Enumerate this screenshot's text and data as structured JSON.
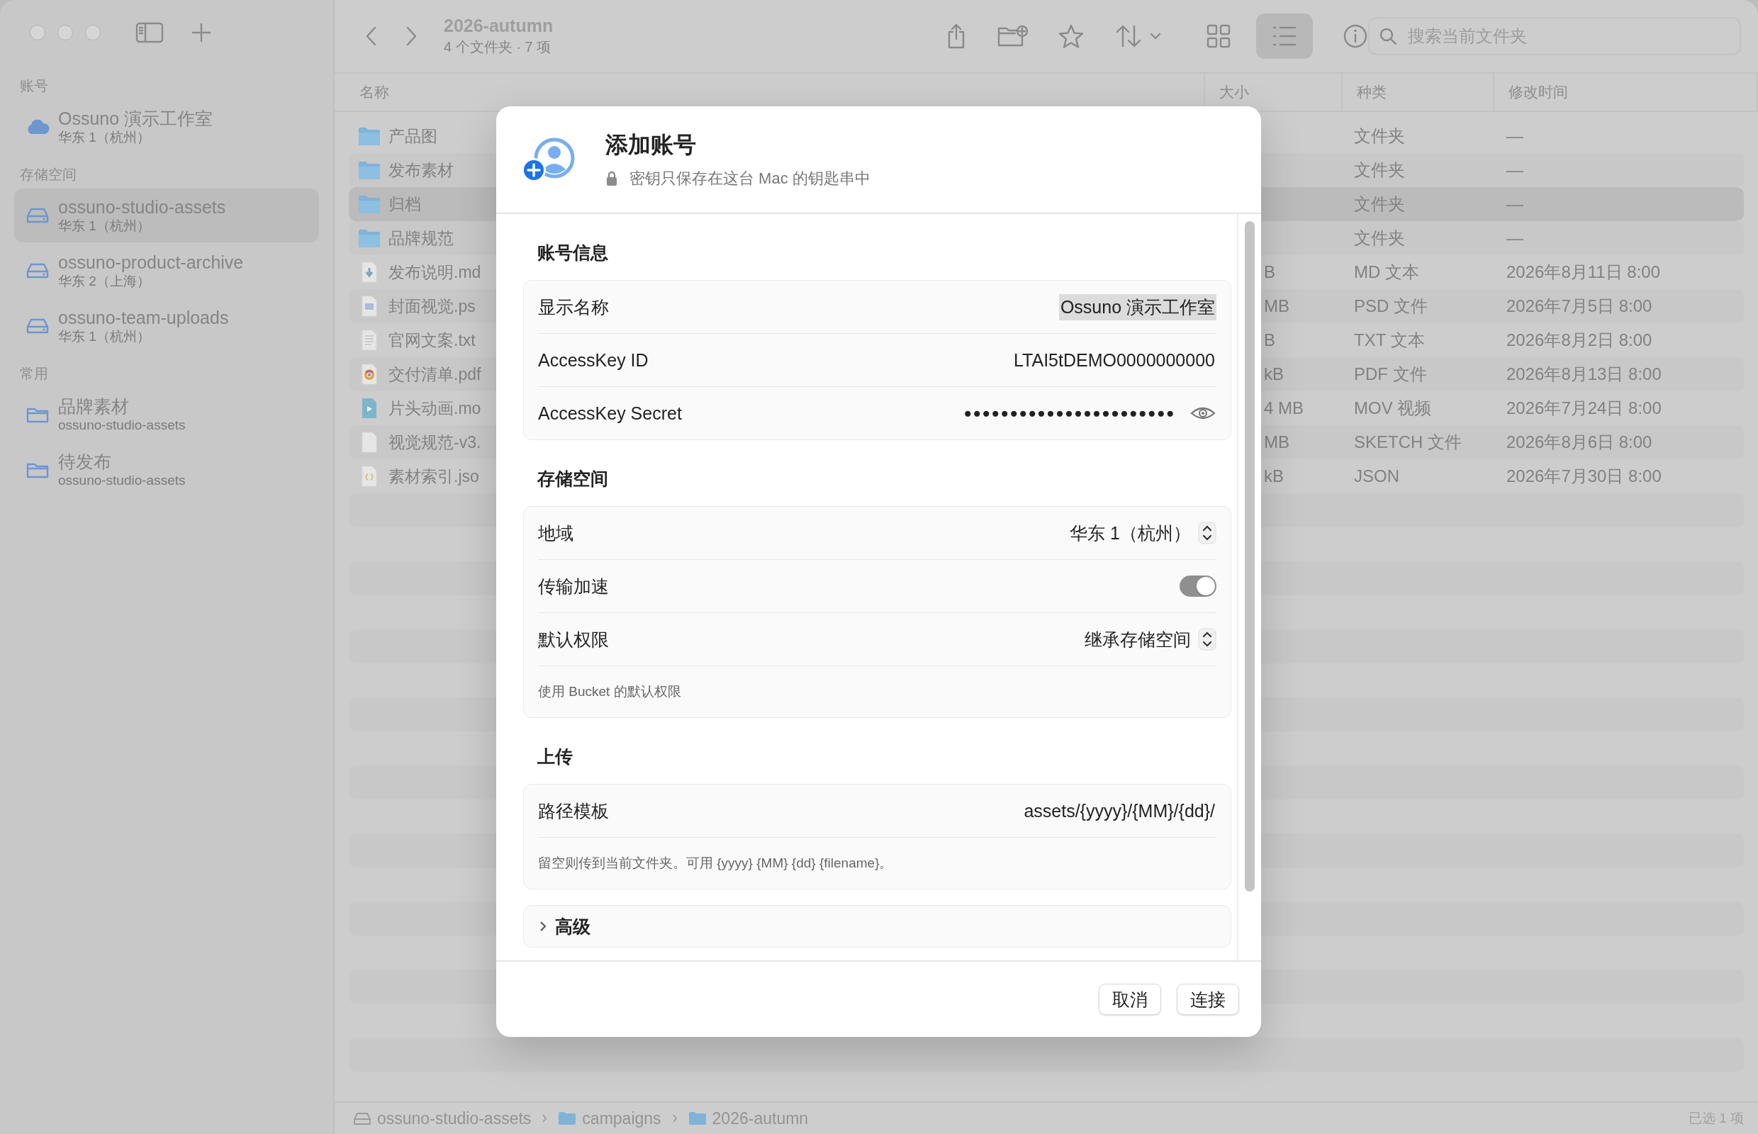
{
  "sidebar": {
    "sections": [
      {
        "title": "账号",
        "items": [
          {
            "kind": "account",
            "label": "Ossuno 演示工作室",
            "sublabel": "华东 1（杭州）",
            "selected": false
          }
        ]
      },
      {
        "title": "存储空间",
        "items": [
          {
            "kind": "bucket",
            "label": "ossuno-studio-assets",
            "sublabel": "华东 1（杭州）",
            "selected": true
          },
          {
            "kind": "bucket",
            "label": "ossuno-product-archive",
            "sublabel": "华东 2（上海）",
            "selected": false
          },
          {
            "kind": "bucket",
            "label": "ossuno-team-uploads",
            "sublabel": "华东 1（杭州）",
            "selected": false
          }
        ]
      },
      {
        "title": "常用",
        "items": [
          {
            "kind": "folder",
            "label": "品牌素材",
            "sublabel": "ossuno-studio-assets",
            "selected": false
          },
          {
            "kind": "folder",
            "label": "待发布",
            "sublabel": "ossuno-studio-assets",
            "selected": false
          }
        ]
      }
    ]
  },
  "toolbar": {
    "title": "2026-autumn",
    "subtitle": "4 个文件夹 · 7 项",
    "view_buttons": [
      {
        "kind": "grid",
        "selected": false
      },
      {
        "kind": "list",
        "selected": true
      }
    ],
    "search": {
      "placeholder": "搜索当前文件夹"
    }
  },
  "file_list": {
    "columns": [
      "名称",
      "大小",
      "种类",
      "修改时间"
    ],
    "rows": [
      {
        "kind": "folder",
        "name": "产品图",
        "type": "文件夹",
        "modified": "—",
        "selected": false
      },
      {
        "kind": "folder",
        "name": "发布素材",
        "type": "文件夹",
        "modified": "—",
        "selected": false
      },
      {
        "kind": "folder",
        "name": "归档",
        "type": "文件夹",
        "modified": "—",
        "selected": true
      },
      {
        "kind": "folder",
        "name": "品牌规范",
        "type": "文件夹",
        "modified": "—",
        "selected": false
      },
      {
        "kind": "markdown",
        "name": "发布说明.md",
        "size": "B",
        "type": "MD 文本",
        "modified": "2026年8月11日 8:00",
        "selected": false
      },
      {
        "kind": "image",
        "name": "封面视觉.ps",
        "size": "MB",
        "type": "PSD 文件",
        "modified": "2026年7月5日 8:00",
        "selected": false
      },
      {
        "kind": "text",
        "name": "官网文案.txt",
        "size": "B",
        "type": "TXT 文本",
        "modified": "2026年8月2日 8:00",
        "selected": false
      },
      {
        "kind": "pdf",
        "name": "交付清单.pdf",
        "size": "kB",
        "type": "PDF 文件",
        "modified": "2026年8月13日 8:00",
        "selected": false
      },
      {
        "kind": "video",
        "name": "片头动画.mo",
        "size": "4 MB",
        "type": "MOV 视频",
        "modified": "2026年7月24日 8:00",
        "selected": false
      },
      {
        "kind": "blank",
        "name": "视觉规范-v3.",
        "size": "MB",
        "type": "SKETCH 文件",
        "modified": "2026年8月6日 8:00",
        "selected": false
      },
      {
        "kind": "json",
        "name": "素材索引.jso",
        "size": "kB",
        "type": "JSON",
        "modified": "2026年7月30日 8:00",
        "selected": false
      }
    ]
  },
  "dialog": {
    "title": "添加账号",
    "subtitle": "密钥只保存在这台 Mac 的钥匙串中",
    "sections": [
      {
        "title": "账号信息",
        "rows": [
          {
            "kind": "text",
            "label": "显示名称",
            "value": "Ossuno 演示工作室",
            "selected": true
          },
          {
            "kind": "text",
            "label": "AccessKey ID",
            "value": "LTAI5tDEMO0000000000",
            "selected": false
          },
          {
            "kind": "secret",
            "label": "AccessKey Secret",
            "value": "●●●●●●●●●●●●●●●●●●●●●●●"
          }
        ]
      },
      {
        "title": "存储空间",
        "rows": [
          {
            "kind": "popup",
            "label": "地域",
            "value": "华东 1（杭州）"
          },
          {
            "kind": "toggle",
            "label": "传输加速",
            "on": true
          },
          {
            "kind": "popup",
            "label": "默认权限",
            "value": "继承存储空间"
          }
        ],
        "note": "使用 Bucket 的默认权限"
      },
      {
        "title": "上传",
        "rows": [
          {
            "kind": "text",
            "label": "路径模板",
            "value": "assets/{yyyy}/{MM}/{dd}/",
            "selected": false
          }
        ],
        "note": "留空则传到当前文件夹。可用 {yyyy} {MM} {dd} {filename}。"
      }
    ],
    "disclosure": {
      "label": "高级",
      "expanded": false
    },
    "buttons": [
      "取消",
      "连接"
    ]
  },
  "status_bar": {
    "path": [
      {
        "kind": "drive",
        "label": "ossuno-studio-assets"
      },
      {
        "kind": "folder",
        "label": "campaigns"
      },
      {
        "kind": "folder",
        "label": "2026-autumn"
      }
    ],
    "selection": "已选 1 项"
  }
}
